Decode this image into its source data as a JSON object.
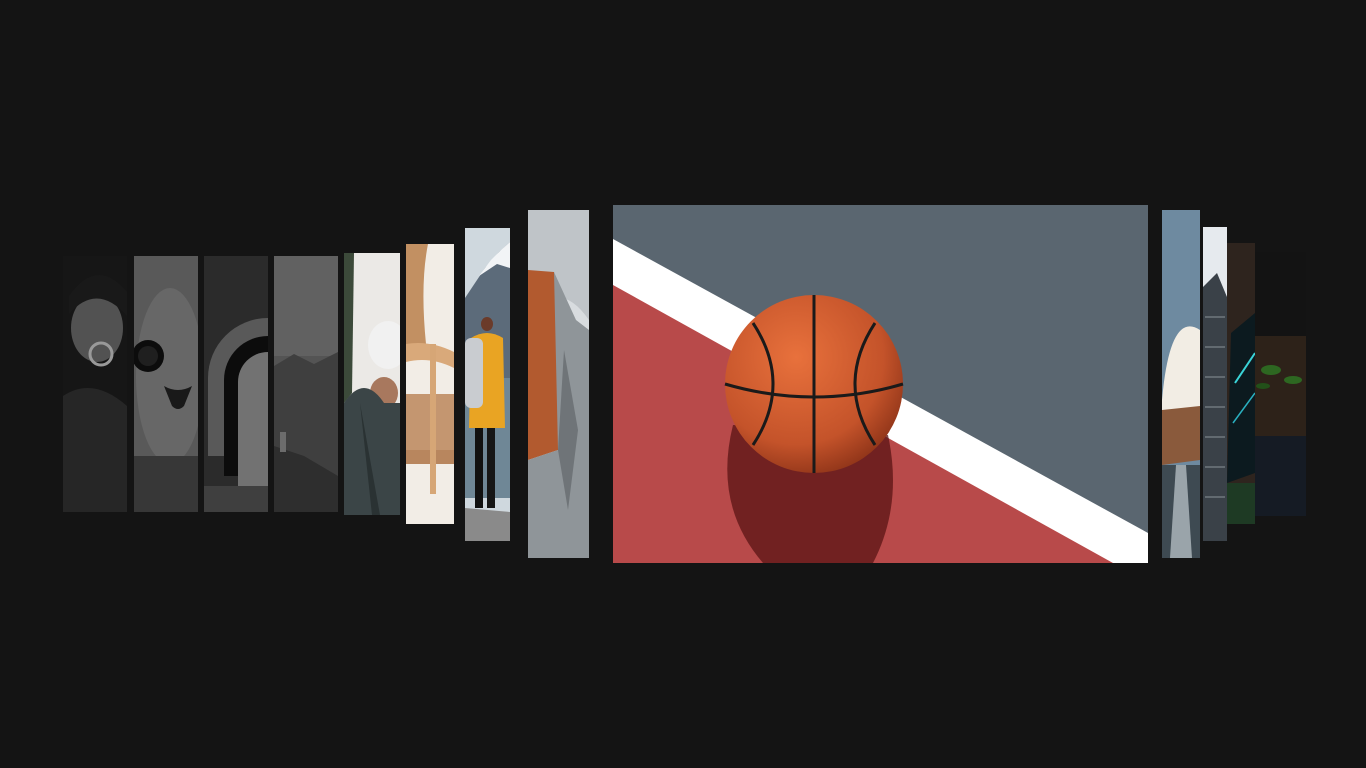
{
  "gallery": {
    "center_item": "basketball-court",
    "left_items": [
      "woman-with-round-glasses",
      "cat-with-sunglasses",
      "metallic-curves",
      "mountain-landscape",
      "man-in-white-cap",
      "wooden-chair",
      "hiker-in-yellow-jacket",
      "rock-cliff"
    ],
    "right_items": [
      "modern-architecture",
      "building-tower",
      "tablet-device",
      "wooden-desk-plant"
    ]
  }
}
